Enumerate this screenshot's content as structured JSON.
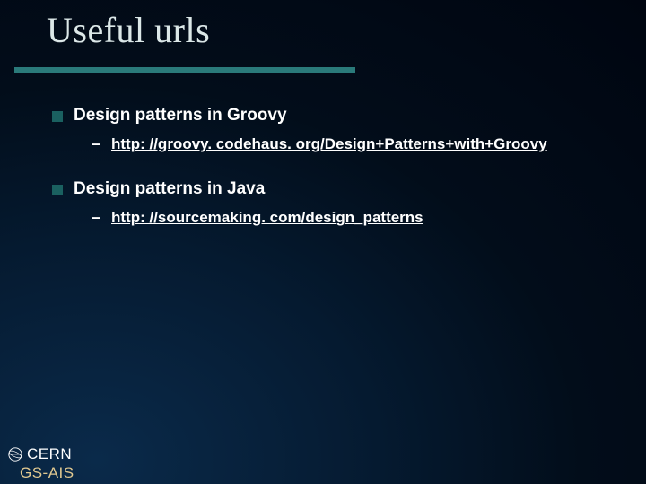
{
  "title": "Useful urls",
  "items": [
    {
      "label": "Design patterns in Groovy",
      "url": "http: //groovy. codehaus. org/Design+Patterns+with+Groovy"
    },
    {
      "label": "Design patterns in Java",
      "url": "http: //sourcemaking. com/design_patterns"
    }
  ],
  "footer": {
    "org": "CERN",
    "dept": "GS-AIS"
  },
  "colors": {
    "accent": "#2a7a7a",
    "bullet": "#1a6060",
    "dept": "#e0c890"
  }
}
